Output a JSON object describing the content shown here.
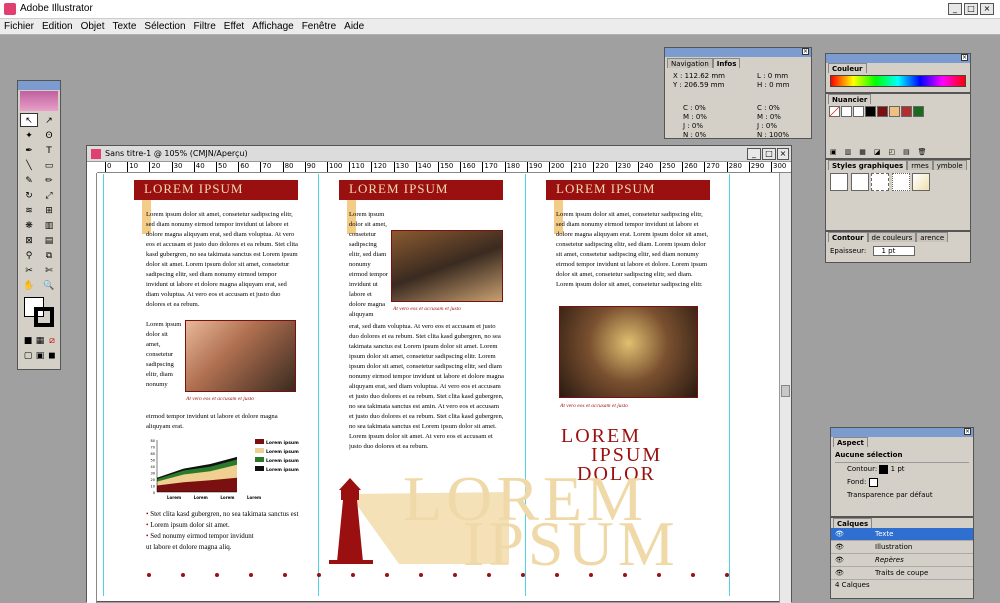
{
  "app": {
    "title": "Adobe Illustrator"
  },
  "menu": [
    "Fichier",
    "Edition",
    "Objet",
    "Texte",
    "Sélection",
    "Filtre",
    "Effet",
    "Affichage",
    "Fenêtre",
    "Aide"
  ],
  "navigation": {
    "tabs": [
      "Navigation",
      "Infos"
    ],
    "x": "X : 112.62 mm",
    "y": "Y : 206.59 mm",
    "l": "L : 0 mm",
    "h": "H : 0 mm",
    "cmyk_left": [
      "C : 0%",
      "M : 0%",
      "J : 0%",
      "N : 0%"
    ],
    "cmyk_right": [
      "C : 0%",
      "M : 0%",
      "J : 0%",
      "N : 100%"
    ]
  },
  "color_panel": {
    "tab": "Couleur"
  },
  "swatches_panel": {
    "tab": "Nuancier",
    "colors": [
      "#ffffff",
      "#000000",
      "#7a1010",
      "#f0c080",
      "#b03030",
      "#1a6a20"
    ]
  },
  "styles_panel": {
    "tabs": [
      "Styles graphiques",
      "rmes",
      "ymbole"
    ]
  },
  "stroke_panel": {
    "tabs": [
      "Contour",
      "de couleurs",
      "arence"
    ],
    "label": "Epaisseur:",
    "value": "1 pt"
  },
  "appearance_panel": {
    "tab": "Aspect",
    "selection": "Aucune sélection",
    "stroke_label": "Contour:",
    "stroke_value": "1 pt",
    "fill_label": "Fond:",
    "opacity": "Transparence par défaut"
  },
  "layers_panel": {
    "tab": "Calques",
    "layers": [
      "Texte",
      "Illustration",
      "Repères",
      "Traits de coupe"
    ],
    "count": "4 Calques"
  },
  "document": {
    "title": "Sans titre-1 @ 105% (CMJN/Aperçu)",
    "ruler": [
      "0",
      "10",
      "20",
      "30",
      "40",
      "50",
      "60",
      "70",
      "80",
      "90",
      "100",
      "110",
      "120",
      "130",
      "140",
      "150",
      "160",
      "170",
      "180",
      "190",
      "200",
      "210",
      "220",
      "230",
      "240",
      "250",
      "260",
      "270",
      "280",
      "290",
      "300"
    ],
    "col1": {
      "heading": "LOREM IPSUM",
      "p1": "Lorem ipsum dolor sit amet, consetetur sadipscing elitr, sed diam nonumy eirmod tempor invidunt ut labore et dolore magna aliquyam erat, sed diam voluptua. At vero eos et accusam et justo duo dolores et ea rebum. Stet clita kasd gubergren, no sea takimata sanctus est Lorem ipsum dolor sit amet. Lorem ipsum dolor sit amet, consetetur sadipscing elitr, sed diam nonumy eirmod tempor invidunt ut labore et dolore magna aliquyam erat, sed diam voluptua. At vero eos et accusam et justo duo dolores et ea rebum.",
      "p1b": "Lorem ipsum dolor sit amet, consetetur sadipscing elitr, diam nonumy",
      "p1c": "eirmod tempor invidunt ut labore et dolore magna aliquyam erat.",
      "caption": "At vero eos et accusam et justo",
      "bullets": [
        "Stet clita kasd gubergren, no sea takimata sanctus est",
        "Lorem ipsum dolor sit amet.",
        "Sed nonumy eirmod tempor invidunt"
      ],
      "tail": "ut labore et dolore magna aliq."
    },
    "col2": {
      "heading": "LOREM IPSUM",
      "narrow": "Lorem ipsum dolor sit amet, consetetur sadipscing elitr, sed diam nonumy eirmod tempor invidunt ut labore et dolore magna aliquyam",
      "caption": "At vero eos et accusam et justo",
      "p2": "erat, sed diam voluptua. At vero eos et accusam et justo duo dolores et ea rebum. Stet clita kasd gubergren, no sea takimata sanctus est Lorem ipsum dolor sit amet. Lorem ipsum dolor sit amet, consetetur sadipscing elitr. Lorem ipsum dolor sit amet, consetetur sadipscing elitr, sed diam nonumy eirmod tempor invidunt ut labore et dolore magna aliquyam erat, sed diam voluptua. At vero eos et accusam et justo duo dolores et ea rebum. Stet clita kasd gubergren, no sea takimata sanctus est amin. At vero eos et accusam et justo duo dolores et ea rebum. Stet clita kasd gubergren, no sea takimata sanctus est Lorem ipsum dolor sit amet. Lorem ipsum dolor sit amet. At vero eos et accusam et justo duo dolores et ea rebum."
    },
    "col3": {
      "heading": "LOREM IPSUM",
      "p1": "Lorem ipsum dolor sit amet, consetetur sadipscing elitr, sed diam nonumy eirmod tempor invidunt ut labore et dolore magna aliquyam erat. Lorem ipsum dolor sit amet, consetetur sadipscing elitr, sed diam. Lorem ipsum dolor sit amet, consetetur sadipscing elitr, sed diam nonumy eirmod tempor invidunt ut labore et dolore. Lorem ipsum dolor sit amet, consetetur sadipscing elitr, sed diam. Lorem ipsum dolor sit amet, consetetur sadipscing elitr.",
      "caption": "At vero eos et accusam et justo",
      "big1": "LOREM",
      "big2": "IPSUM",
      "big3": "DOLOR"
    },
    "big_beige": [
      "LOREM",
      "IPSUM"
    ],
    "chart_legend": [
      "Lorem ipsum",
      "Lorem ipsum",
      "Lorem ipsum",
      "Lorem ipsum"
    ],
    "chart_xlabels": [
      "Lorem",
      "Lorem",
      "Lorem",
      "Lorem"
    ]
  },
  "chart_data": {
    "type": "area",
    "categories": [
      "Lorem",
      "Lorem",
      "Lorem",
      "Lorem"
    ],
    "ylim": [
      0,
      80
    ],
    "ticks": [
      "80",
      "70",
      "60",
      "50",
      "40",
      "30",
      "20",
      "10",
      "0"
    ],
    "series": [
      {
        "name": "Lorem ipsum",
        "color": "#7a1010",
        "values": [
          10,
          15,
          18,
          22
        ]
      },
      {
        "name": "Lorem ipsum",
        "color": "#f0d090",
        "values": [
          6,
          12,
          14,
          20
        ]
      },
      {
        "name": "Lorem ipsum",
        "color": "#2a7a2a",
        "values": [
          4,
          6,
          7,
          8
        ]
      },
      {
        "name": "Lorem ipsum",
        "color": "#111111",
        "values": [
          2,
          3,
          4,
          4
        ]
      }
    ],
    "legend": "right"
  }
}
